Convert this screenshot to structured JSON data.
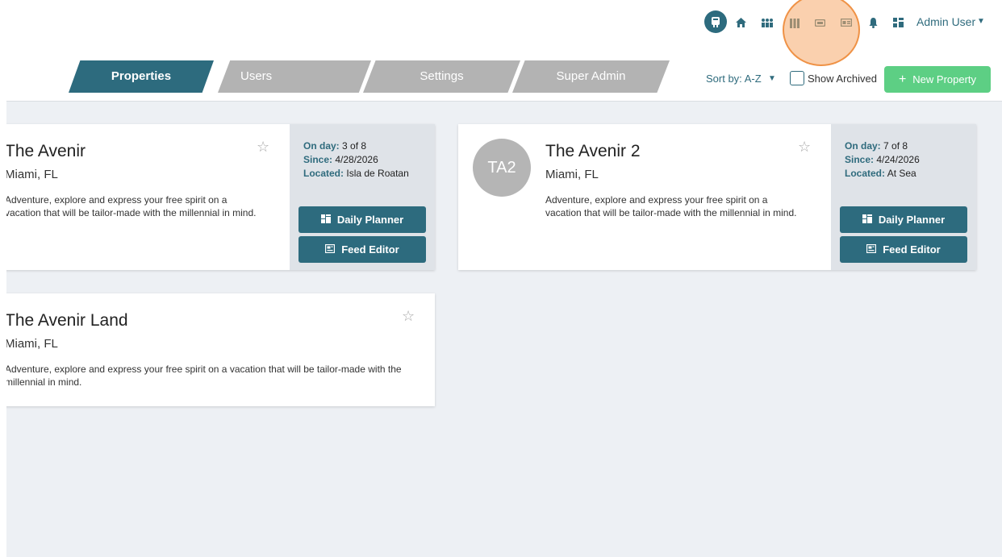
{
  "header": {
    "icons": [
      "property-icon",
      "home-icon",
      "people-icon",
      "library-icon",
      "ticket-icon",
      "id-card-icon",
      "bell-icon",
      "dashboard-icon"
    ],
    "admin_name": "Admin User"
  },
  "tabs": [
    {
      "label": "Properties",
      "active": true
    },
    {
      "label": "Users",
      "active": false
    },
    {
      "label": "Settings",
      "active": false
    },
    {
      "label": "Super Admin",
      "active": false
    }
  ],
  "controls": {
    "sort_label": "Sort by: A-Z",
    "show_archived_label": "Show Archived",
    "show_archived_checked": false,
    "new_property_label": "New Property"
  },
  "properties": [
    {
      "name": "The Avenir",
      "location": "Miami, FL",
      "description": "Adventure, explore and express your free spirit on a vacation that will be tailor-made with the millennial in mind.",
      "on_day_key": "On day:",
      "on_day": "3 of 8",
      "since_key": "Since:",
      "since": "4/28/2026",
      "located_key": "Located:",
      "located": "Isla de Roatan",
      "daily_planner_label": "Daily Planner",
      "feed_editor_label": "Feed Editor"
    },
    {
      "name": "The Avenir 2",
      "avatar": "TA2",
      "location": "Miami, FL",
      "description": "Adventure, explore and express your free spirit on a vacation that will be tailor-made with the millennial in mind.",
      "on_day_key": "On day:",
      "on_day": "7 of 8",
      "since_key": "Since:",
      "since": "4/24/2026",
      "located_key": "Located:",
      "located": "At Sea",
      "daily_planner_label": "Daily Planner",
      "feed_editor_label": "Feed Editor"
    },
    {
      "name": "The Avenir Land",
      "location": "Miami, FL",
      "description": "Adventure, explore and express your free spirit on a vacation that will be tailor-made with the millennial in mind."
    }
  ],
  "colors": {
    "primary": "#2d6b7e",
    "success": "#5dcf84",
    "inactive_tab": "#b3b3b3",
    "background": "#edf0f4"
  }
}
